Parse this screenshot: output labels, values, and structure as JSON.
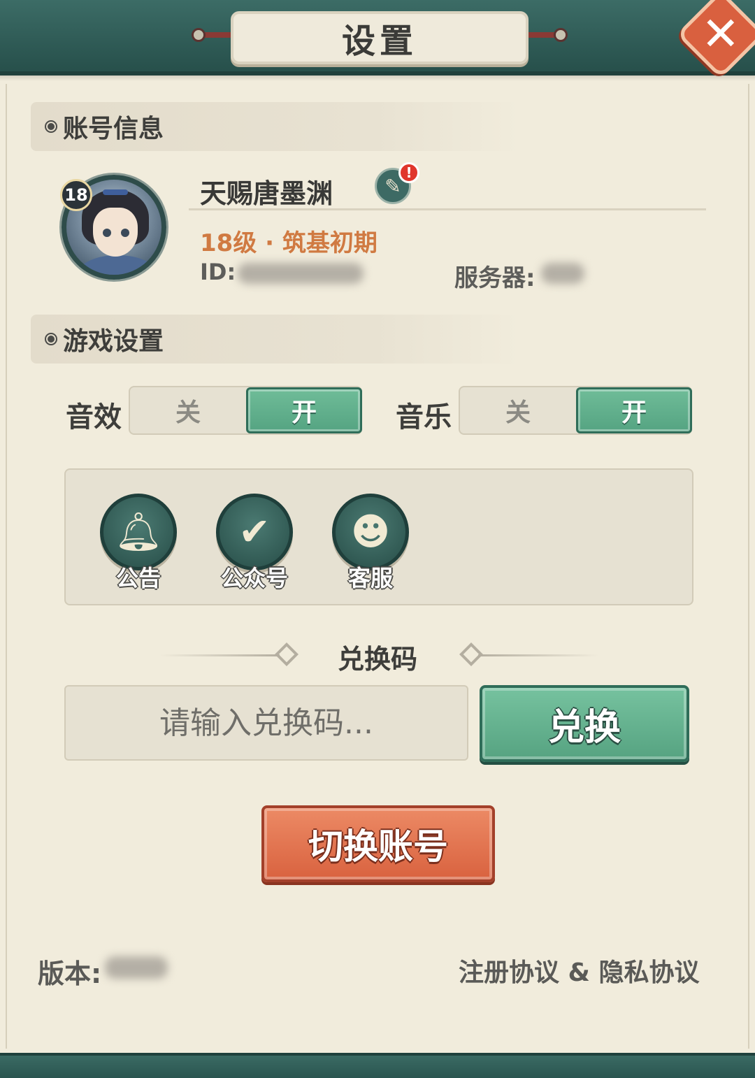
{
  "header": {
    "title": "设置",
    "close_icon": "close-icon"
  },
  "account_section": {
    "title": "账号信息"
  },
  "player": {
    "level_badge": "18",
    "name": "天赐唐墨渊",
    "level_text": "18级 · 筑基初期",
    "id_label": "ID:",
    "id_value": "",
    "server_label": "服务器:",
    "server_value": "",
    "edit_alert": "!"
  },
  "game_section": {
    "title": "游戏设置"
  },
  "toggles": {
    "sound": {
      "label": "音效",
      "off": "关",
      "on": "开",
      "state": "on"
    },
    "music": {
      "label": "音乐",
      "off": "关",
      "on": "开",
      "state": "on"
    }
  },
  "shortcuts": [
    {
      "label": "公告",
      "icon": "bell-icon"
    },
    {
      "label": "公众号",
      "icon": "chat-bubble-icon"
    },
    {
      "label": "客服",
      "icon": "headset-icon"
    }
  ],
  "redeem": {
    "title": "兑换码",
    "placeholder": "请输入兑换码...",
    "button": "兑换"
  },
  "switch_account": {
    "label": "切换账号"
  },
  "footer": {
    "version_label": "版本:",
    "version_value": "",
    "policy_link": "注册协议 & 隐私协议"
  },
  "colors": {
    "panel": "#f1ecdc",
    "header_band": "#2d5853",
    "toggle_on": "#5fae8a",
    "switch_button": "#d9623f",
    "level_text": "#d07a42"
  }
}
